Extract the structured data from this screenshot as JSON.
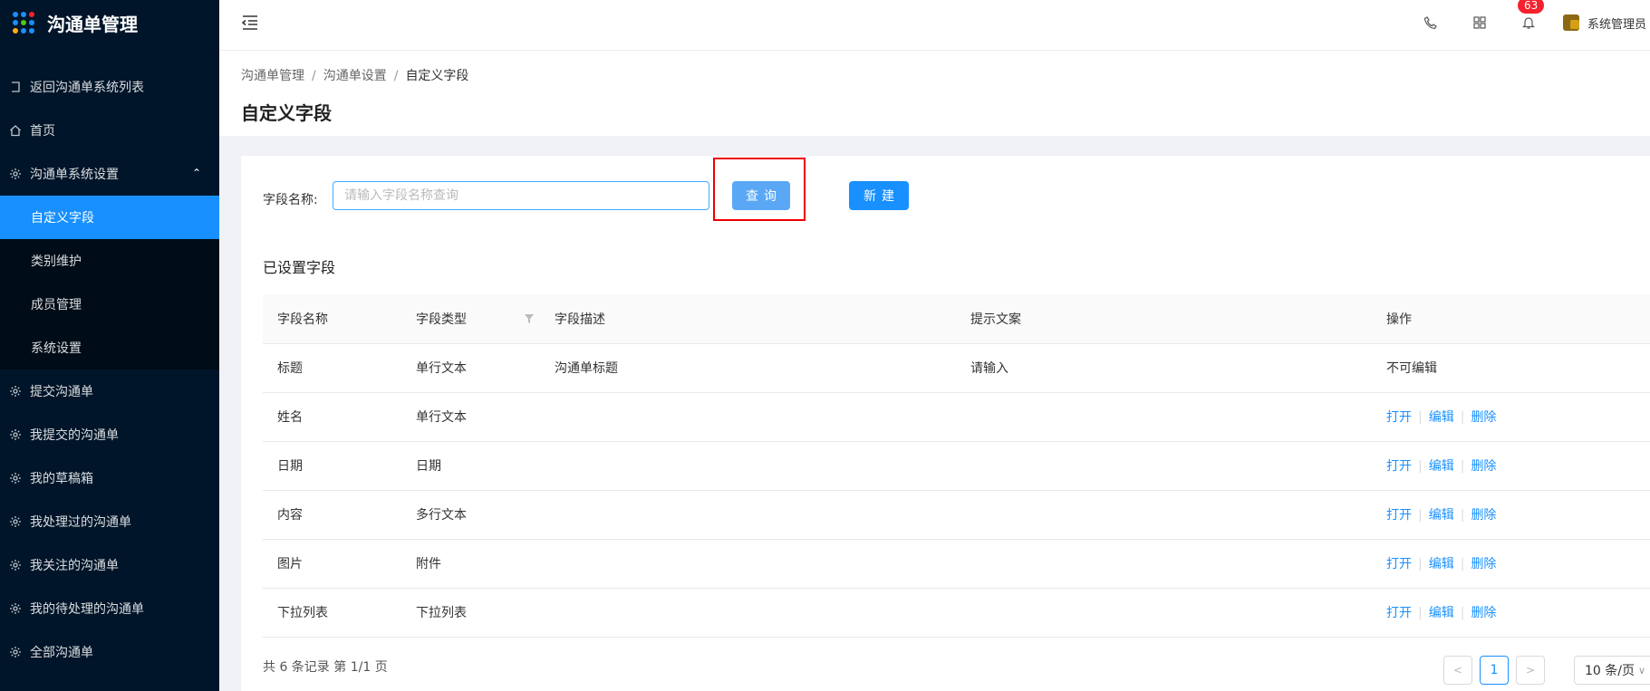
{
  "app": {
    "title": "沟通单管理"
  },
  "sidebar": {
    "back_label": "返回沟通单系统列表",
    "home_label": "首页",
    "settings_group": {
      "label": "沟通单系统设置",
      "items": [
        {
          "label": "自定义字段",
          "active": true
        },
        {
          "label": "类别维护"
        },
        {
          "label": "成员管理"
        },
        {
          "label": "系统设置"
        }
      ]
    },
    "items": [
      {
        "label": "提交沟通单"
      },
      {
        "label": "我提交的沟通单"
      },
      {
        "label": "我的草稿箱"
      },
      {
        "label": "我处理过的沟通单"
      },
      {
        "label": "我关注的沟通单"
      },
      {
        "label": "我的待处理的沟通单"
      },
      {
        "label": "全部沟通单"
      }
    ]
  },
  "header": {
    "notification_count": "63",
    "user_name": "系统管理员"
  },
  "breadcrumb": [
    "沟通单管理",
    "沟通单设置",
    "自定义字段"
  ],
  "breadcrumb_sep": "/",
  "page_title": "自定义字段",
  "search": {
    "label": "字段名称:",
    "placeholder": "请输入字段名称查询",
    "value": "",
    "query_label": "查询",
    "new_label": "新建"
  },
  "section_title": "已设置字段",
  "table": {
    "columns": [
      "字段名称",
      "字段类型",
      "字段描述",
      "提示文案",
      "操作"
    ],
    "rows": [
      {
        "name": "标题",
        "type": "单行文本",
        "desc": "沟通单标题",
        "hint": "请输入",
        "action_text": "不可编辑"
      },
      {
        "name": "姓名",
        "type": "单行文本",
        "desc": "",
        "hint": ""
      },
      {
        "name": "日期",
        "type": "日期",
        "desc": "",
        "hint": ""
      },
      {
        "name": "内容",
        "type": "多行文本",
        "desc": "",
        "hint": ""
      },
      {
        "name": "图片",
        "type": "附件",
        "desc": "",
        "hint": ""
      },
      {
        "name": "下拉列表",
        "type": "下拉列表",
        "desc": "",
        "hint": ""
      }
    ],
    "actions": {
      "open": "打开",
      "edit": "编辑",
      "delete": "删除",
      "sep": "|"
    }
  },
  "pagination": {
    "summary": "共 6 条记录 第 1/1 页",
    "current_page": "1",
    "page_size": "10 条/页"
  },
  "colors": {
    "sidebar_bg": "#001529",
    "accent": "#1890ff",
    "badge": "#f5222d",
    "highlight": "#ee0000"
  }
}
